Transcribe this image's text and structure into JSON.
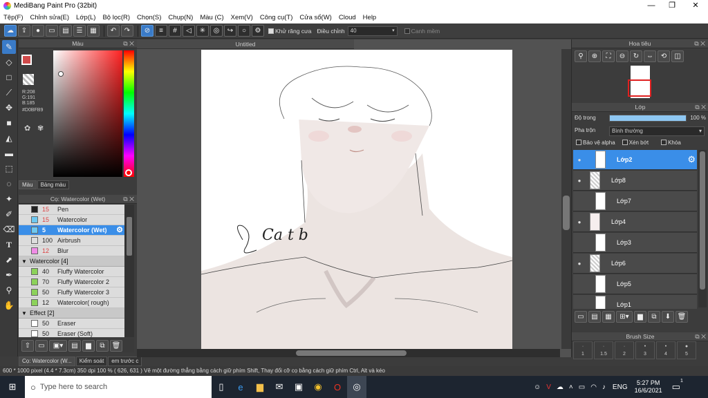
{
  "app": {
    "title": "MediBang Paint Pro (32bit)"
  },
  "window": {
    "minimize": "—",
    "maximize": "❐",
    "close": "✕"
  },
  "menu": [
    "Tệp(F)",
    "Chỉnh sửa(E)",
    "Lớp(L)",
    "Bộ lọc(R)",
    "Chọn(S)",
    "Chụp(N)",
    "Màu (C)",
    "Xem(V)",
    "Công cụ(T)",
    "Cửa sổ(W)",
    "Cloud",
    "Help"
  ],
  "toolbar": {
    "antialias": "Khử răng cưa",
    "adjust_label": "Điều chỉnh",
    "adjust_value": "40",
    "edge_label": "Canh mềm"
  },
  "color_panel": {
    "title": "Màu",
    "r": "R:208",
    "g": "G:191",
    "b": "B:185",
    "hex": "#D0BFB9",
    "tabs": [
      "Màu",
      "Bảng màu"
    ]
  },
  "brush_panel": {
    "title": "Cọ: Watercolor (Wet)",
    "items_top": [
      {
        "size": "15",
        "name": "Pen",
        "color": "#222222",
        "red": true
      },
      {
        "size": "15",
        "name": "Watercolor",
        "color": "#6ec8f0",
        "red": true
      },
      {
        "size": "5",
        "name": "Watercolor (Wet)",
        "color": "#6ec8f0",
        "red": false,
        "selected": true
      },
      {
        "size": "100",
        "name": "Airbrush",
        "color": "#dddddd",
        "red": false
      },
      {
        "size": "12",
        "name": "Blur",
        "color": "#f08ce6",
        "red": true
      }
    ],
    "group1": "Watercolor [4]",
    "items_g1": [
      {
        "size": "40",
        "name": "Fluffy Watercolor",
        "color": "#8cd25a"
      },
      {
        "size": "70",
        "name": "Fluffy Watercolor 2",
        "color": "#8cd25a"
      },
      {
        "size": "50",
        "name": "Fluffy Watercolor 3",
        "color": "#8cd25a"
      },
      {
        "size": "12",
        "name": "Watercolor( rough)",
        "color": "#8cd25a"
      }
    ],
    "group2": "Effect [2]",
    "items_g2": [
      {
        "size": "50",
        "name": "Eraser",
        "color": "#ffffff"
      },
      {
        "size": "50",
        "name": "Eraser (Soft)",
        "color": "#ffffff"
      }
    ]
  },
  "bottom_tabs": [
    "Cọ: Watercolor (W...",
    "Kiểm soát",
    "em trước c"
  ],
  "canvas": {
    "tab": "Untitled",
    "signature": "Ca t b"
  },
  "navigator": {
    "title": "Hoa tiêu"
  },
  "layer_panel": {
    "title": "Lớp",
    "opacity_label": "Độ trong",
    "opacity_value": "100 %",
    "opacity_fraction": 1.0,
    "blend_label": "Pha trộn",
    "blend_value": "Bình thường",
    "protect_alpha": "Bảo vệ alpha",
    "clip": "Xén bớt",
    "lock": "Khóa",
    "layers": [
      "Lớp2",
      "Lớp8",
      "Lớp7",
      "Lớp4",
      "Lớp3",
      "Lớp6",
      "Lớp5",
      "Lớp1"
    ]
  },
  "brush_size": {
    "title": "Brush Size",
    "sizes": [
      "1",
      "1.5",
      "2",
      "3",
      "4",
      "5"
    ]
  },
  "status": "600 * 1000 pixel   (4.4 * 7.3cm)   350 dpi   100 %   ( 626, 631 )   Vẽ một đường thẳng bằng cách giữ phím Shift, Thay đổi cỡ cọ bằng cách giữ phím Ctrl, Alt và kéo",
  "taskbar": {
    "search_placeholder": "Type here to search",
    "lang": "ENG",
    "time": "5:27 PM",
    "date": "16/6/2021",
    "notif": "1"
  }
}
